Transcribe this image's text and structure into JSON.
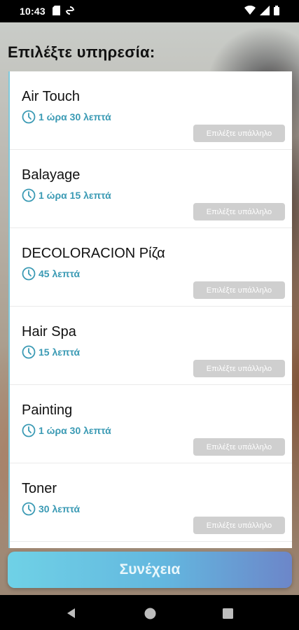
{
  "status_bar": {
    "time": "10:43",
    "icons_left": [
      "sd-card-icon",
      "sync-icon"
    ],
    "icons_right": [
      "wifi-icon",
      "signal-icon",
      "battery-icon"
    ]
  },
  "page": {
    "title": "Επιλέξτε υπηρεσία:"
  },
  "services": [
    {
      "name": "Air Touch",
      "duration": "1 ώρα 30 λεπτά",
      "employee_button": "Επιλέξτε υπάλληλο"
    },
    {
      "name": "Balayage",
      "duration": "1 ώρα 15 λεπτά",
      "employee_button": "Επιλέξτε υπάλληλο"
    },
    {
      "name": "DECOLORACION Ρίζα",
      "duration": "45 λεπτά",
      "employee_button": "Επιλέξτε υπάλληλο"
    },
    {
      "name": "Hair Spa",
      "duration": "15 λεπτά",
      "employee_button": "Επιλέξτε υπάλληλο"
    },
    {
      "name": "Painting",
      "duration": "1 ώρα 30 λεπτά",
      "employee_button": "Επιλέξτε υπάλληλο"
    },
    {
      "name": "Toner",
      "duration": "30 λεπτά",
      "employee_button": "Επιλέξτε υπάλληλο"
    }
  ],
  "continue_button": {
    "label": "Συνέχεια"
  },
  "colors": {
    "accent": "#3a9ab4",
    "button_disabled": "#cfcfcf",
    "continue_gradient_start": "#6fd1e6",
    "continue_gradient_end": "#6c86c9"
  },
  "nav_bar": {
    "buttons": [
      "back-icon",
      "home-icon",
      "recents-icon"
    ]
  }
}
